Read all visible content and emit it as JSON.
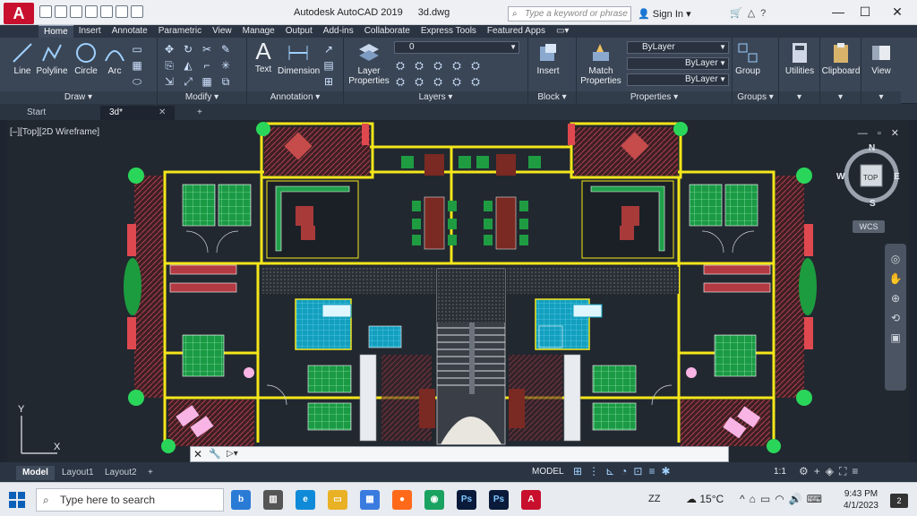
{
  "titlebar": {
    "app_title": "Autodesk AutoCAD 2019",
    "file_name": "3d.dwg",
    "search_placeholder": "Type a keyword or phrase",
    "signin_label": "Sign In",
    "minimize": "—",
    "maximize": "☐",
    "close": "✕"
  },
  "ribbon_tabs": [
    "Home",
    "Insert",
    "Annotate",
    "Parametric",
    "View",
    "Manage",
    "Output",
    "Add-ins",
    "Collaborate",
    "Express Tools",
    "Featured Apps"
  ],
  "ribbon": {
    "draw": {
      "title": "Draw ▾",
      "line": "Line",
      "polyline": "Polyline",
      "circle": "Circle",
      "arc": "Arc"
    },
    "modify": {
      "title": "Modify ▾"
    },
    "annotation": {
      "title": "Annotation ▾",
      "text": "Text",
      "dimension": "Dimension"
    },
    "layers": {
      "title": "Layers ▾",
      "layer_properties": "Layer Properties",
      "layer_value": "0"
    },
    "block": {
      "title": "Block ▾",
      "insert": "Insert"
    },
    "properties": {
      "title": "Properties ▾",
      "match": "Match Properties",
      "color": "ByLayer",
      "linetype": "ByLayer",
      "lineweight": "ByLayer"
    },
    "groups": {
      "title": "Groups ▾",
      "group": "Group"
    },
    "utilities": "Utilities",
    "clipboard": "Clipboard",
    "view": "View"
  },
  "file_tabs": {
    "start": "Start",
    "drawing": "3d*",
    "add": "+"
  },
  "canvas": {
    "viewport_label": "[–][Top][2D Wireframe]",
    "viewcube_top": "TOP",
    "north": "N",
    "south": "S",
    "east": "E",
    "west": "W",
    "wcs": "WCS",
    "ucs_y": "Y",
    "ucs_x": "X"
  },
  "command_line": {
    "prompt": "▷▾"
  },
  "layout_tabs": [
    "Model",
    "Layout1",
    "Layout2"
  ],
  "layout_add": "+",
  "status": {
    "model": "MODEL",
    "scale": "1:1"
  },
  "taskbar": {
    "search_placeholder": "Type here to search",
    "lang": "ZZ",
    "temperature": "15°C",
    "time": "9:43 PM",
    "date": "4/1/2023",
    "notifications": "2"
  },
  "colors": {
    "wall": "#f5e61a",
    "floor_green": "#19a84a",
    "hatch": "#8c2a3a",
    "cyan": "#17c4e0"
  }
}
